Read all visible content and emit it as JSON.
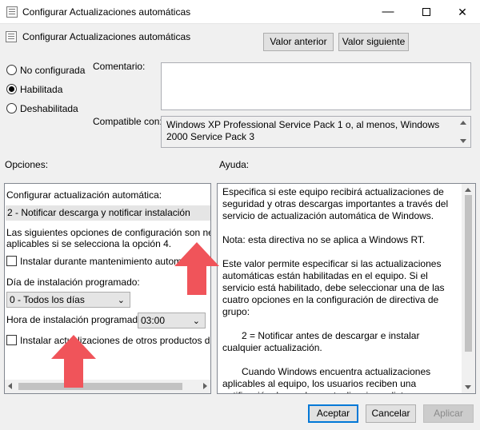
{
  "window": {
    "title": "Configurar Actualizaciones automáticas",
    "minimize_glyph": "—",
    "close_glyph": "✕"
  },
  "header": {
    "title": "Configurar Actualizaciones automáticas",
    "prev_button": "Valor anterior",
    "next_button": "Valor siguiente"
  },
  "state": {
    "options": [
      {
        "label": "No configurada",
        "checked": false
      },
      {
        "label": "Habilitada",
        "checked": true
      },
      {
        "label": "Deshabilitada",
        "checked": false
      }
    ]
  },
  "comment": {
    "label": "Comentario:",
    "value": ""
  },
  "compatibility": {
    "label": "Compatible con:",
    "value": "Windows XP Professional Service Pack 1 o, al menos, Windows 2000 Service Pack 3"
  },
  "options_section": {
    "label": "Opciones:",
    "configure_label": "Configurar actualización automática:",
    "configure_value": "2 - Notificar descarga y notificar instalación",
    "info_text_line1": "Las siguientes opciones de configuración son necesarias",
    "info_text_line2": "aplicables si se selecciona la opción 4.",
    "maintenance_checkbox": "Instalar durante mantenimiento automático",
    "day_label": "Día de instalación programado:",
    "day_value": "0 - Todos los días",
    "time_label": "Hora de instalación programada:",
    "time_value": "03:00",
    "other_products_checkbox": "Instalar actualizaciones de otros productos de Micros",
    "chevron_glyph": "⌄"
  },
  "help_section": {
    "label": "Ayuda:",
    "paragraphs": [
      "Especifica si este equipo recibirá actualizaciones de seguridad y otras descargas importantes a través del servicio de actualización automática de Windows.",
      "Nota: esta directiva no se aplica a Windows RT.",
      "Este valor permite especificar si las actualizaciones automáticas están habilitadas en el equipo. Si el servicio está habilitado, debe seleccionar una de las cuatro opciones en la configuración de directiva de grupo:",
      "2 = Notificar antes de descargar e instalar cualquier actualización.",
      "Cuando Windows encuentra actualizaciones aplicables al equipo, los usuarios reciben una notificación de que hay actualizaciones listas para descargarse. Después de ir a Windows Update, los usuarios pueden descargar e instalar cualquier actualización disponible."
    ]
  },
  "footer": {
    "ok_button": "Aceptar",
    "cancel_button": "Cancelar",
    "apply_button": "Aplicar"
  },
  "colors": {
    "annotation_arrow": "#f0545a",
    "accent": "#0078d7"
  }
}
